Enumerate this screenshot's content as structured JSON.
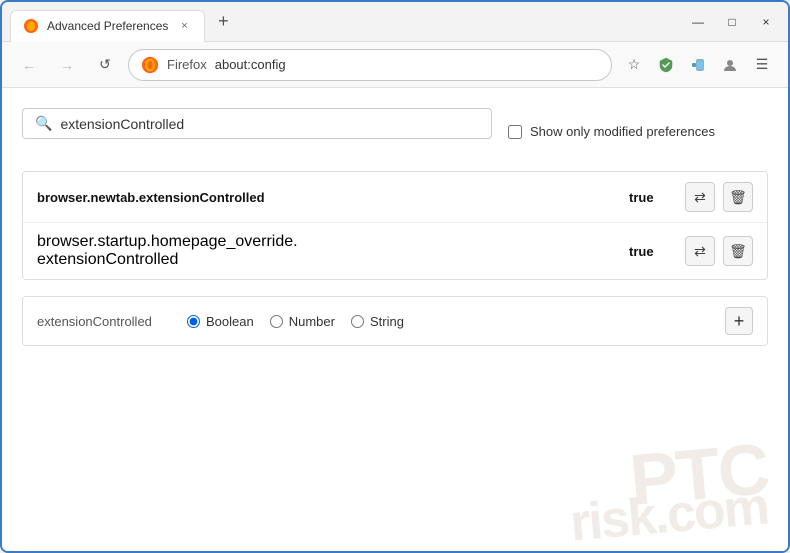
{
  "window": {
    "title": "Advanced Preferences",
    "close_label": "×",
    "minimize_label": "—",
    "maximize_label": "□",
    "new_tab_label": "+"
  },
  "navbar": {
    "back_label": "←",
    "forward_label": "→",
    "reload_label": "↺",
    "site_name": "Firefox",
    "url": "about:config",
    "star_label": "☆",
    "shield_label": "🛡",
    "extensions_label": "🧩",
    "menu_label": "☰"
  },
  "search": {
    "placeholder": "",
    "value": "extensionControlled",
    "show_modified_label": "Show only modified preferences"
  },
  "preferences": [
    {
      "name": "browser.newtab.extensionControlled",
      "value": "true"
    },
    {
      "name_line1": "browser.startup.homepage_override.",
      "name_line2": "extensionControlled",
      "value": "true"
    }
  ],
  "add_row": {
    "name": "extensionControlled",
    "boolean_label": "Boolean",
    "number_label": "Number",
    "string_label": "String",
    "add_label": "+"
  },
  "watermark": {
    "line1": "PTC",
    "line2": "risk.com"
  }
}
